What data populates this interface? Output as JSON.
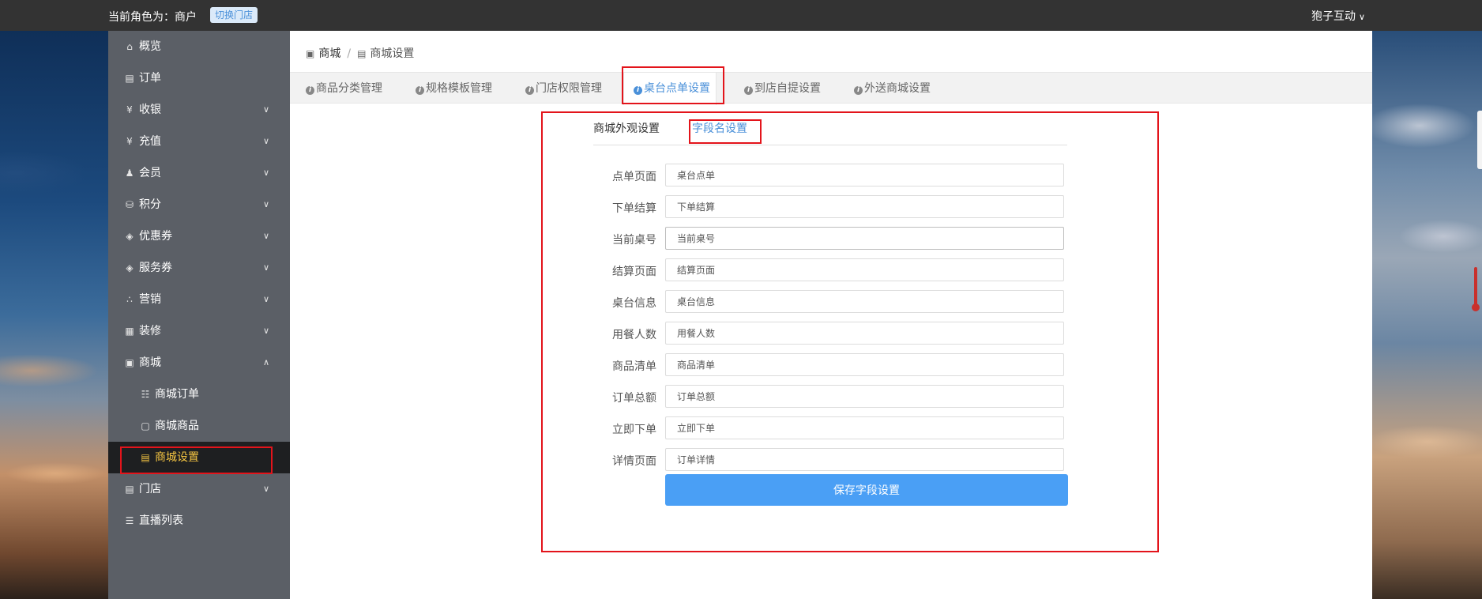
{
  "topbar": {
    "role_text": "当前角色为：商户",
    "switch_store_label": "切换门店",
    "user_name": "狍子互动"
  },
  "sidebar": {
    "items": [
      {
        "label": "概览",
        "icon": "home-icon"
      },
      {
        "label": "订单",
        "icon": "order-icon"
      },
      {
        "label": "收银",
        "icon": "cashier-icon"
      },
      {
        "label": "充值",
        "icon": "recharge-icon"
      },
      {
        "label": "会员",
        "icon": "member-icon"
      },
      {
        "label": "积分",
        "icon": "points-icon"
      },
      {
        "label": "优惠券",
        "icon": "coupon-icon"
      },
      {
        "label": "服务券",
        "icon": "service-coupon-icon"
      },
      {
        "label": "营销",
        "icon": "marketing-icon"
      },
      {
        "label": "装修",
        "icon": "decoration-icon"
      },
      {
        "label": "商城",
        "icon": "mall-icon"
      },
      {
        "label": "商城订单",
        "icon": "cart-icon"
      },
      {
        "label": "商城商品",
        "icon": "goods-icon"
      },
      {
        "label": "商城设置",
        "icon": "store-settings-icon"
      },
      {
        "label": "门店",
        "icon": "store-icon"
      },
      {
        "label": "直播列表",
        "icon": "live-list-icon"
      }
    ]
  },
  "breadcrumb": {
    "root": "商城",
    "separator": "/",
    "current": "商城设置"
  },
  "tabs": [
    {
      "label": "商品分类管理"
    },
    {
      "label": "规格模板管理"
    },
    {
      "label": "门店权限管理"
    },
    {
      "label": "桌台点单设置"
    },
    {
      "label": "到店自提设置"
    },
    {
      "label": "外送商城设置"
    }
  ],
  "subtabs": [
    {
      "label": "商城外观设置"
    },
    {
      "label": "字段名设置"
    }
  ],
  "fields": [
    {
      "label": "点单页面",
      "value": "桌台点单"
    },
    {
      "label": "下单结算",
      "value": "下单结算"
    },
    {
      "label": "当前桌号",
      "value": "当前桌号"
    },
    {
      "label": "结算页面",
      "value": "结算页面"
    },
    {
      "label": "桌台信息",
      "value": "桌台信息"
    },
    {
      "label": "用餐人数",
      "value": "用餐人数"
    },
    {
      "label": "商品清单",
      "value": "商品清单"
    },
    {
      "label": "订单总额",
      "value": "订单总额"
    },
    {
      "label": "立即下单",
      "value": "立即下单"
    },
    {
      "label": "详情页面",
      "value": "订单详情"
    }
  ],
  "save_button": {
    "label": "保存字段设置"
  },
  "colors": {
    "topbar": "#333333",
    "sidebar": "#5b5f66",
    "active_item_bg": "#1e1f21",
    "active_item_text": "#f5c542",
    "accent": "#4a90d9",
    "button": "#4a9ff5",
    "highlight_box": "#e3141b"
  }
}
